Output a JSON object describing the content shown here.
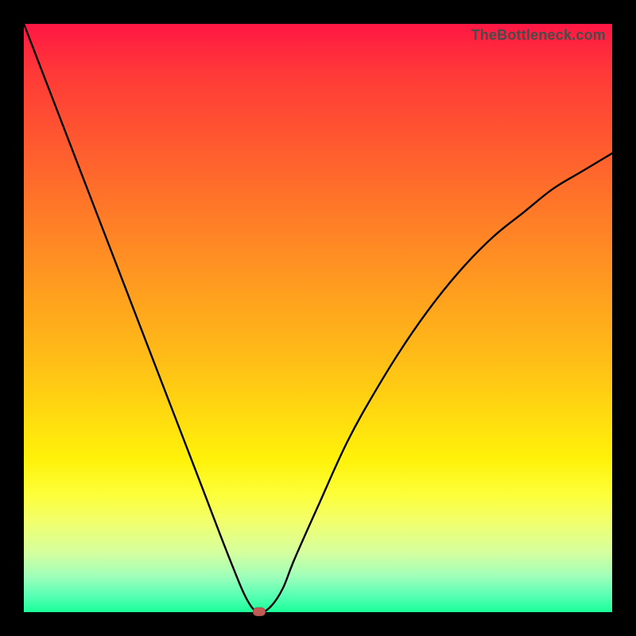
{
  "watermark": {
    "text": "TheBottleneck.com"
  },
  "colors": {
    "border": "#000000",
    "curve": "#000000",
    "marker": "#c05a55"
  },
  "chart_data": {
    "type": "line",
    "title": "",
    "xlabel": "",
    "ylabel": "",
    "xlim": [
      0,
      100
    ],
    "ylim": [
      0,
      100
    ],
    "grid": false,
    "legend": false,
    "series": [
      {
        "name": "bottleneck-curve",
        "x": [
          0,
          5,
          10,
          15,
          20,
          25,
          30,
          35,
          38,
          40,
          42,
          44,
          46,
          50,
          55,
          60,
          65,
          70,
          75,
          80,
          85,
          90,
          95,
          100
        ],
        "y": [
          100,
          87,
          74,
          61,
          48,
          35,
          22,
          9,
          2,
          0,
          1,
          4,
          9,
          18,
          29,
          38,
          46,
          53,
          59,
          64,
          68,
          72,
          75,
          78
        ]
      }
    ],
    "annotations": [
      {
        "type": "marker",
        "name": "minimum-point",
        "x": 40,
        "y": 0
      }
    ]
  }
}
